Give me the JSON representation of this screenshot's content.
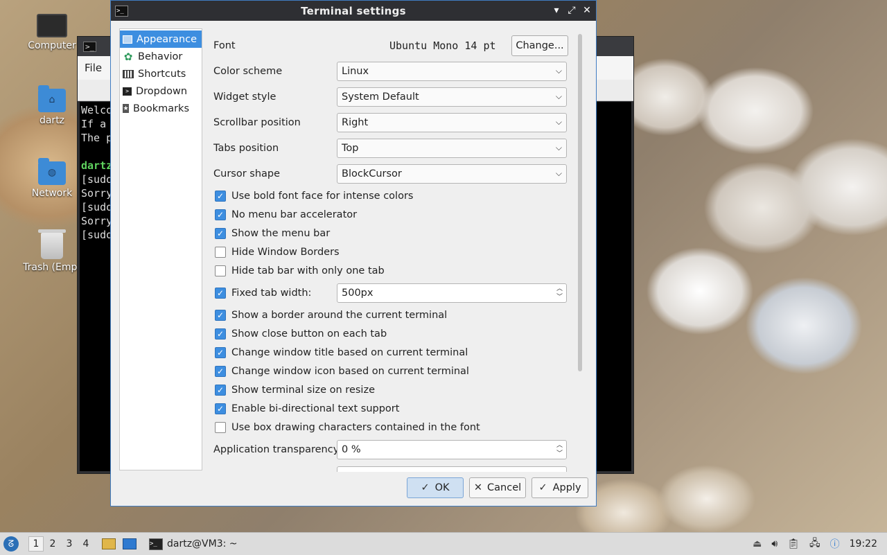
{
  "desktop": {
    "icons": [
      {
        "label": "Computer",
        "icon": "monitor-icon"
      },
      {
        "label": "dartz",
        "icon": "home-folder-icon"
      },
      {
        "label": "Network",
        "icon": "network-folder-icon"
      },
      {
        "label": "Trash (Empt",
        "icon": "trash-icon"
      }
    ]
  },
  "bg_terminal": {
    "menu_file": "File",
    "lines": [
      "Welco",
      "If a",
      "The p",
      "",
      "dartz",
      "[sudo",
      "Sorry",
      "[sudo",
      "Sorry",
      "[sudo"
    ]
  },
  "dialog": {
    "title": "Terminal settings",
    "window_buttons": {
      "minimize": "▾",
      "maximize": "⤢",
      "close": "✕"
    },
    "sidebar": [
      {
        "label": "Appearance",
        "icon": "appearance-icon",
        "selected": true
      },
      {
        "label": "Behavior",
        "icon": "behavior-icon"
      },
      {
        "label": "Shortcuts",
        "icon": "keyboard-icon"
      },
      {
        "label": "Dropdown",
        "icon": "dropdown-terminal-icon"
      },
      {
        "label": "Bookmarks",
        "icon": "bookmark-icon"
      }
    ],
    "font": {
      "label": "Font",
      "value": "Ubuntu Mono 14 pt",
      "button": "Change..."
    },
    "combos": {
      "color_scheme": {
        "label": "Color scheme",
        "value": "Linux"
      },
      "widget_style": {
        "label": "Widget style",
        "value": "System Default"
      },
      "scrollbar_position": {
        "label": "Scrollbar position",
        "value": "Right"
      },
      "tabs_position": {
        "label": "Tabs position",
        "value": "Top"
      },
      "cursor_shape": {
        "label": "Cursor shape",
        "value": "BlockCursor"
      }
    },
    "checks_a": [
      {
        "label": "Use bold font face for intense colors",
        "checked": true
      },
      {
        "label": "No menu bar accelerator",
        "checked": true
      },
      {
        "label": "Show the menu bar",
        "checked": true
      },
      {
        "label": "Hide Window Borders",
        "checked": false
      },
      {
        "label": "Hide tab bar with only one tab",
        "checked": false
      }
    ],
    "fixed_tab_width": {
      "label": "Fixed tab width:",
      "checked": true,
      "value": "500px"
    },
    "checks_b": [
      {
        "label": "Show a border around the current terminal",
        "checked": true
      },
      {
        "label": "Show close button on each tab",
        "checked": true
      },
      {
        "label": "Change window title based on current terminal",
        "checked": true
      },
      {
        "label": "Change window icon based on current terminal",
        "checked": true
      },
      {
        "label": "Show terminal size on resize",
        "checked": true
      },
      {
        "label": "Enable bi-directional text support",
        "checked": true
      },
      {
        "label": "Use box drawing characters contained in the font",
        "checked": false
      }
    ],
    "app_transparency": {
      "label": "Application transparency",
      "value": "0 %"
    },
    "buttons": {
      "ok": "OK",
      "cancel": "Cancel",
      "apply": "Apply"
    }
  },
  "taskbar": {
    "workspaces": [
      "1",
      "2",
      "3",
      "4"
    ],
    "current_workspace": "1",
    "task_label": "dartz@VM3: ~",
    "clock": "19:22"
  },
  "colors": {
    "accent": "#3d8ee0",
    "titlebar": "#2e2f33"
  }
}
